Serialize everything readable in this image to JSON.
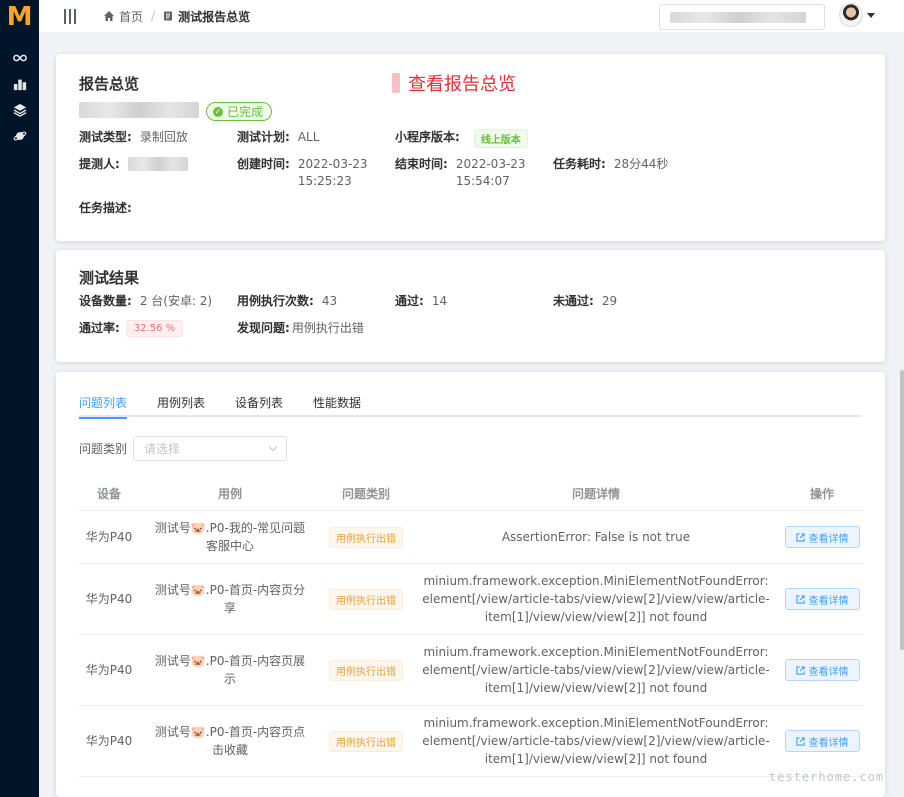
{
  "sidebar": {
    "logo": "M",
    "items": [
      {
        "icon": "infinity-icon"
      },
      {
        "icon": "bar-chart-icon"
      },
      {
        "icon": "layers-icon"
      },
      {
        "icon": "planet-icon"
      }
    ]
  },
  "header": {
    "breadcrumb": {
      "home": "首页",
      "current": "测试报告总览"
    }
  },
  "overview": {
    "title": "报告总览",
    "link": "查看报告总览",
    "status": "已完成",
    "fields": {
      "test_type_label": "测试类型:",
      "test_type": "录制回放",
      "plan_label": "测试计划:",
      "plan": "ALL",
      "version_label": "小程序版本:",
      "version": "线上版本",
      "submitter_label": "提测人:",
      "created_label": "创建时间:",
      "created_date": "2022-03-23",
      "created_time": "15:25:23",
      "ended_label": "结束时间:",
      "ended_date": "2022-03-23",
      "ended_time": "15:54:07",
      "duration_label": "任务耗时:",
      "duration": "28分44秒",
      "desc_label": "任务描述:"
    }
  },
  "results": {
    "title": "测试结果",
    "device_count_label": "设备数量:",
    "device_count": "2 台(安卓: 2)",
    "exec_count_label": "用例执行次数:",
    "exec_count": "43",
    "passed_label": "通过:",
    "passed": "14",
    "failed_label": "未通过:",
    "failed": "29",
    "pass_rate_label": "通过率:",
    "pass_rate": "32.56 %",
    "issues_label": "发现问题:",
    "issues": "用例执行出错"
  },
  "tabs": [
    "问题列表",
    "用例列表",
    "设备列表",
    "性能数据"
  ],
  "filter": {
    "label": "问题类别",
    "placeholder": "请选择"
  },
  "table": {
    "headers": [
      "设备",
      "用例",
      "问题类别",
      "问题详情",
      "操作"
    ],
    "rows": [
      {
        "device": "华为P40",
        "case_prefix": "测试号",
        "pig": "🐷",
        "case_suffix": ".P0-我的-常见问题客服中心",
        "type": "用例执行出错",
        "detail": "AssertionError: False is not true",
        "action": "查看详情"
      },
      {
        "device": "华为P40",
        "case_prefix": "测试号",
        "pig": "🐷",
        "case_suffix": ".P0-首页-内容页分享",
        "type": "用例执行出错",
        "detail": "minium.framework.exception.MiniElementNotFoundError: element[/view/article-tabs/view/view[2]/view/view/article-item[1]/view/view/view[2]] not found",
        "action": "查看详情"
      },
      {
        "device": "华为P40",
        "case_prefix": "测试号",
        "pig": "🐷",
        "case_suffix": ".P0-首页-内容页展示",
        "type": "用例执行出错",
        "detail": "minium.framework.exception.MiniElementNotFoundError: element[/view/article-tabs/view/view[2]/view/view/article-item[1]/view/view/view[2]] not found",
        "action": "查看详情"
      },
      {
        "device": "华为P40",
        "case_prefix": "测试号",
        "pig": "🐷",
        "case_suffix": ".P0-首页-内容页点击收藏",
        "type": "用例执行出错",
        "detail": "minium.framework.exception.MiniElementNotFoundError: element[/view/article-tabs/view/view[2]/view/view/article-item[1]/view/view/view[2]] not found",
        "action": "查看详情"
      }
    ]
  },
  "watermark": "testerhome.com",
  "colors": {
    "accent": "#409eff",
    "danger": "#f56c6c",
    "success": "#67c23a",
    "warning": "#e6a23c",
    "sidebar": "#001529",
    "logo": "#f5a623"
  }
}
